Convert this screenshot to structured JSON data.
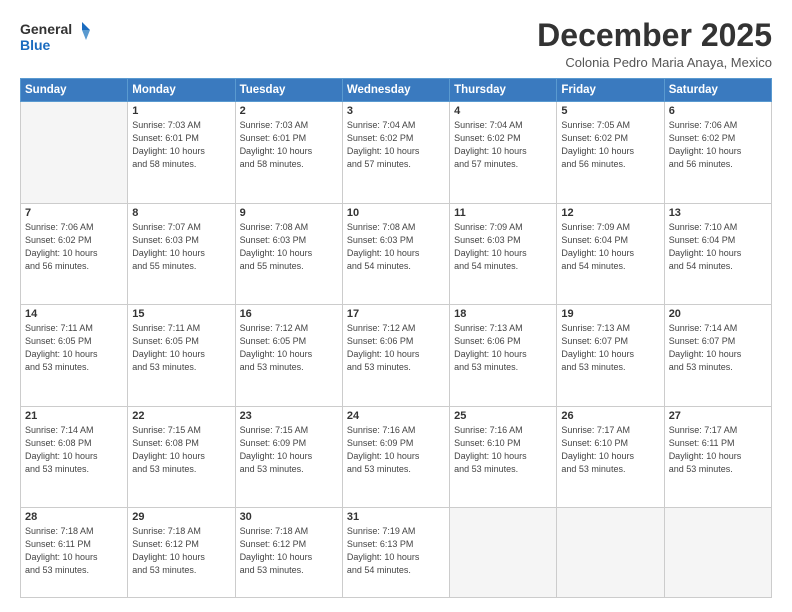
{
  "header": {
    "logo_line1": "General",
    "logo_line2": "Blue",
    "month_title": "December 2025",
    "location": "Colonia Pedro Maria Anaya, Mexico"
  },
  "weekdays": [
    "Sunday",
    "Monday",
    "Tuesday",
    "Wednesday",
    "Thursday",
    "Friday",
    "Saturday"
  ],
  "weeks": [
    [
      {
        "day": "",
        "info": ""
      },
      {
        "day": "1",
        "info": "Sunrise: 7:03 AM\nSunset: 6:01 PM\nDaylight: 10 hours\nand 58 minutes."
      },
      {
        "day": "2",
        "info": "Sunrise: 7:03 AM\nSunset: 6:01 PM\nDaylight: 10 hours\nand 58 minutes."
      },
      {
        "day": "3",
        "info": "Sunrise: 7:04 AM\nSunset: 6:02 PM\nDaylight: 10 hours\nand 57 minutes."
      },
      {
        "day": "4",
        "info": "Sunrise: 7:04 AM\nSunset: 6:02 PM\nDaylight: 10 hours\nand 57 minutes."
      },
      {
        "day": "5",
        "info": "Sunrise: 7:05 AM\nSunset: 6:02 PM\nDaylight: 10 hours\nand 56 minutes."
      },
      {
        "day": "6",
        "info": "Sunrise: 7:06 AM\nSunset: 6:02 PM\nDaylight: 10 hours\nand 56 minutes."
      }
    ],
    [
      {
        "day": "7",
        "info": "Sunrise: 7:06 AM\nSunset: 6:02 PM\nDaylight: 10 hours\nand 56 minutes."
      },
      {
        "day": "8",
        "info": "Sunrise: 7:07 AM\nSunset: 6:03 PM\nDaylight: 10 hours\nand 55 minutes."
      },
      {
        "day": "9",
        "info": "Sunrise: 7:08 AM\nSunset: 6:03 PM\nDaylight: 10 hours\nand 55 minutes."
      },
      {
        "day": "10",
        "info": "Sunrise: 7:08 AM\nSunset: 6:03 PM\nDaylight: 10 hours\nand 54 minutes."
      },
      {
        "day": "11",
        "info": "Sunrise: 7:09 AM\nSunset: 6:03 PM\nDaylight: 10 hours\nand 54 minutes."
      },
      {
        "day": "12",
        "info": "Sunrise: 7:09 AM\nSunset: 6:04 PM\nDaylight: 10 hours\nand 54 minutes."
      },
      {
        "day": "13",
        "info": "Sunrise: 7:10 AM\nSunset: 6:04 PM\nDaylight: 10 hours\nand 54 minutes."
      }
    ],
    [
      {
        "day": "14",
        "info": "Sunrise: 7:11 AM\nSunset: 6:05 PM\nDaylight: 10 hours\nand 53 minutes."
      },
      {
        "day": "15",
        "info": "Sunrise: 7:11 AM\nSunset: 6:05 PM\nDaylight: 10 hours\nand 53 minutes."
      },
      {
        "day": "16",
        "info": "Sunrise: 7:12 AM\nSunset: 6:05 PM\nDaylight: 10 hours\nand 53 minutes."
      },
      {
        "day": "17",
        "info": "Sunrise: 7:12 AM\nSunset: 6:06 PM\nDaylight: 10 hours\nand 53 minutes."
      },
      {
        "day": "18",
        "info": "Sunrise: 7:13 AM\nSunset: 6:06 PM\nDaylight: 10 hours\nand 53 minutes."
      },
      {
        "day": "19",
        "info": "Sunrise: 7:13 AM\nSunset: 6:07 PM\nDaylight: 10 hours\nand 53 minutes."
      },
      {
        "day": "20",
        "info": "Sunrise: 7:14 AM\nSunset: 6:07 PM\nDaylight: 10 hours\nand 53 minutes."
      }
    ],
    [
      {
        "day": "21",
        "info": "Sunrise: 7:14 AM\nSunset: 6:08 PM\nDaylight: 10 hours\nand 53 minutes."
      },
      {
        "day": "22",
        "info": "Sunrise: 7:15 AM\nSunset: 6:08 PM\nDaylight: 10 hours\nand 53 minutes."
      },
      {
        "day": "23",
        "info": "Sunrise: 7:15 AM\nSunset: 6:09 PM\nDaylight: 10 hours\nand 53 minutes."
      },
      {
        "day": "24",
        "info": "Sunrise: 7:16 AM\nSunset: 6:09 PM\nDaylight: 10 hours\nand 53 minutes."
      },
      {
        "day": "25",
        "info": "Sunrise: 7:16 AM\nSunset: 6:10 PM\nDaylight: 10 hours\nand 53 minutes."
      },
      {
        "day": "26",
        "info": "Sunrise: 7:17 AM\nSunset: 6:10 PM\nDaylight: 10 hours\nand 53 minutes."
      },
      {
        "day": "27",
        "info": "Sunrise: 7:17 AM\nSunset: 6:11 PM\nDaylight: 10 hours\nand 53 minutes."
      }
    ],
    [
      {
        "day": "28",
        "info": "Sunrise: 7:18 AM\nSunset: 6:11 PM\nDaylight: 10 hours\nand 53 minutes."
      },
      {
        "day": "29",
        "info": "Sunrise: 7:18 AM\nSunset: 6:12 PM\nDaylight: 10 hours\nand 53 minutes."
      },
      {
        "day": "30",
        "info": "Sunrise: 7:18 AM\nSunset: 6:12 PM\nDaylight: 10 hours\nand 53 minutes."
      },
      {
        "day": "31",
        "info": "Sunrise: 7:19 AM\nSunset: 6:13 PM\nDaylight: 10 hours\nand 54 minutes."
      },
      {
        "day": "",
        "info": ""
      },
      {
        "day": "",
        "info": ""
      },
      {
        "day": "",
        "info": ""
      }
    ]
  ]
}
